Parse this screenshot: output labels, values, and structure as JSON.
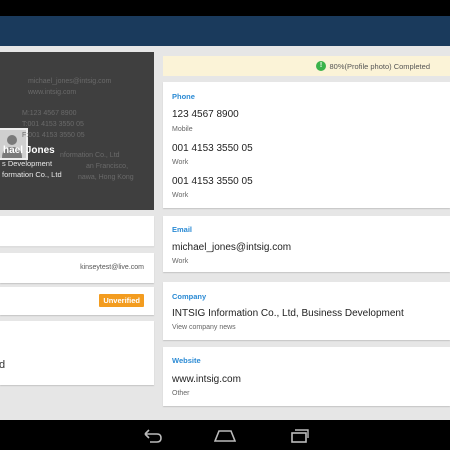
{
  "card": {
    "email_line": "michael_jones@intsig.com",
    "web_line": "www.intsig.com",
    "mobile_line": "M:123 4567 8900",
    "tel_line": "T:001 4153 3550 05",
    "fax_line": "F:001 4153 3550 05",
    "name": "hael Jones",
    "title": "s Development",
    "company_line": "formation Co., Ltd",
    "company_faint": "nformation Co., Ltd",
    "addr1": "an Francisco,",
    "addr2": "nawa, Hong Kong"
  },
  "left": {
    "email": "kinseytest@live.com",
    "badge": "Unverified",
    "fragment": "d"
  },
  "banner": {
    "icon": "!",
    "text": "80%(Profile photo) Completed"
  },
  "phone": {
    "section": "Phone",
    "entries": [
      {
        "value": "123 4567 8900",
        "label": "Mobile"
      },
      {
        "value": "001 4153 3550 05",
        "label": "Work"
      },
      {
        "value": "001 4153 3550 05",
        "label": "Work"
      }
    ]
  },
  "email": {
    "section": "Email",
    "value": "michael_jones@intsig.com",
    "label": "Work"
  },
  "company": {
    "section": "Company",
    "value": "INTSIG Information Co., Ltd, Business Development",
    "link": "View company news"
  },
  "website": {
    "section": "Website",
    "value": "www.intsig.com",
    "label": "Other"
  },
  "icons": {
    "back": "back-icon",
    "home": "home-icon",
    "recents": "recents-icon",
    "avatar": "avatar-icon",
    "info": "info-icon"
  },
  "colors": {
    "actionbar": "#1a3a5c",
    "section": "#2a8ad4",
    "badge": "#f39c1f",
    "banner": "#fbf3d7",
    "info": "#3bb34a"
  }
}
